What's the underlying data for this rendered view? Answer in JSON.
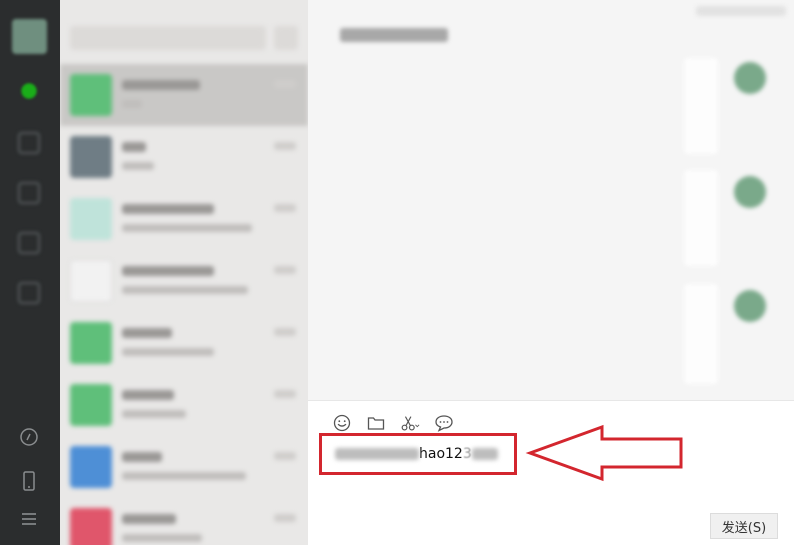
{
  "sidebar": {
    "icons": [
      "avatar",
      "chat-icon",
      "contacts-icon",
      "favorites-icon",
      "files-icon",
      "moments-icon",
      "phone-icon",
      "menu-icon"
    ]
  },
  "conversation_list": {
    "items": [
      {
        "avatar_color": "#5fbf7a",
        "active": true
      },
      {
        "avatar_color": "#6f7d85",
        "active": false
      },
      {
        "avatar_color": "#bfe3da",
        "active": false
      },
      {
        "avatar_color": "#f2f2f2",
        "active": false
      },
      {
        "avatar_color": "#5fbf7a",
        "active": false
      },
      {
        "avatar_color": "#5fbf7a",
        "active": false
      },
      {
        "avatar_color": "#4e8fd6",
        "active": false
      },
      {
        "avatar_color": "#e0566b",
        "active": false
      }
    ]
  },
  "input": {
    "visible_text": "hao12",
    "visible_text_2": "3"
  },
  "toolbar": {
    "icons": [
      "emoji-icon",
      "folder-icon",
      "scissors-icon",
      "chat-bubble-icon"
    ]
  },
  "send_button": {
    "label": "发送(S)"
  },
  "colors": {
    "highlight": "#d3262e",
    "rail": "#2b2d2e",
    "accent": "#1aad19"
  }
}
